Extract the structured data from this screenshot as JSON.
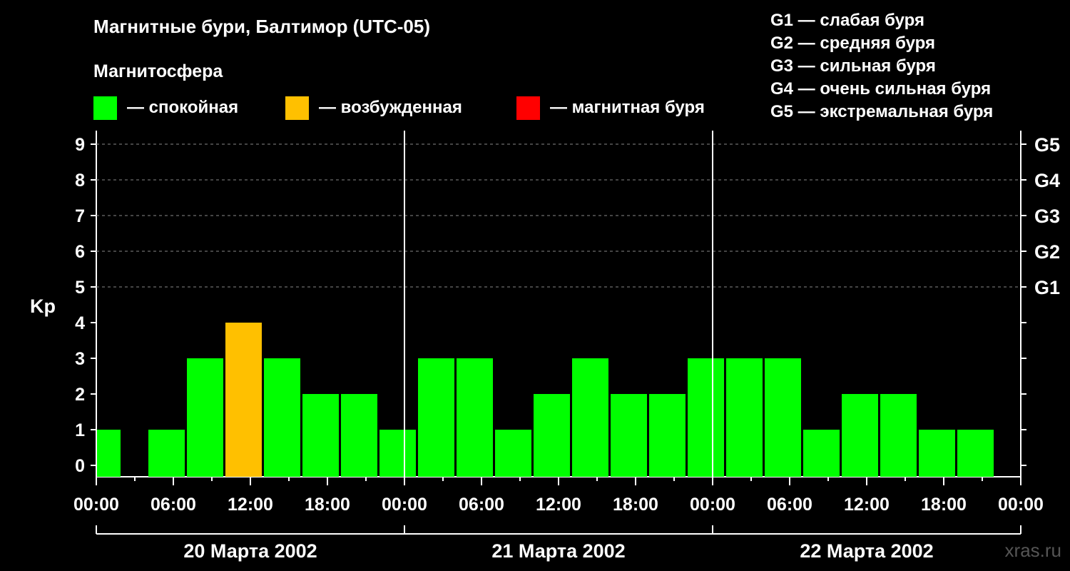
{
  "title": "Магнитные бури, Балтимор (UTC-05)",
  "subtitle": "Магнитосфера",
  "legend": [
    {
      "label": "— спокойная",
      "color": "#00ff00"
    },
    {
      "label": "— возбужденная",
      "color": "#ffc000"
    },
    {
      "label": "— магнитная буря",
      "color": "#ff0000"
    }
  ],
  "g_legend": [
    "G1 — слабая буря",
    "G2 — средняя буря",
    "G3 — сильная буря",
    "G4 — очень сильная буря",
    "G5 — экстремальная буря"
  ],
  "watermark": "xras.ru",
  "chart_data": {
    "type": "bar",
    "ylabel": "Kp",
    "ylim": [
      0,
      9
    ],
    "y_ticks": [
      "0",
      "1",
      "2",
      "3",
      "4",
      "5",
      "6",
      "7",
      "8",
      "9"
    ],
    "g_levels": [
      {
        "label": "G1",
        "value": 5
      },
      {
        "label": "G2",
        "value": 6
      },
      {
        "label": "G3",
        "value": 7
      },
      {
        "label": "G4",
        "value": 8
      },
      {
        "label": "G5",
        "value": 9
      }
    ],
    "x_tick_labels": [
      "00:00",
      "06:00",
      "12:00",
      "18:00",
      "00:00",
      "06:00",
      "12:00",
      "18:00",
      "00:00",
      "06:00",
      "12:00",
      "18:00",
      "00:00"
    ],
    "days": [
      "20 Марта 2002",
      "21 Марта 2002",
      "22 Марта 2002"
    ],
    "bars": [
      {
        "start_hour": 0,
        "end_hour": 2,
        "value": 1,
        "level": "quiet"
      },
      {
        "start_hour": 4,
        "end_hour": 7,
        "value": 1,
        "level": "quiet"
      },
      {
        "start_hour": 7,
        "end_hour": 10,
        "value": 3,
        "level": "quiet"
      },
      {
        "start_hour": 10,
        "end_hour": 13,
        "value": 4,
        "level": "active"
      },
      {
        "start_hour": 13,
        "end_hour": 16,
        "value": 3,
        "level": "quiet"
      },
      {
        "start_hour": 16,
        "end_hour": 19,
        "value": 2,
        "level": "quiet"
      },
      {
        "start_hour": 19,
        "end_hour": 22,
        "value": 2,
        "level": "quiet"
      },
      {
        "start_hour": 22,
        "end_hour": 25,
        "value": 1,
        "level": "quiet"
      },
      {
        "start_hour": 25,
        "end_hour": 28,
        "value": 3,
        "level": "quiet"
      },
      {
        "start_hour": 28,
        "end_hour": 31,
        "value": 3,
        "level": "quiet"
      },
      {
        "start_hour": 31,
        "end_hour": 34,
        "value": 1,
        "level": "quiet"
      },
      {
        "start_hour": 34,
        "end_hour": 37,
        "value": 2,
        "level": "quiet"
      },
      {
        "start_hour": 37,
        "end_hour": 40,
        "value": 3,
        "level": "quiet"
      },
      {
        "start_hour": 40,
        "end_hour": 43,
        "value": 2,
        "level": "quiet"
      },
      {
        "start_hour": 43,
        "end_hour": 46,
        "value": 2,
        "level": "quiet"
      },
      {
        "start_hour": 46,
        "end_hour": 49,
        "value": 3,
        "level": "quiet"
      },
      {
        "start_hour": 49,
        "end_hour": 52,
        "value": 3,
        "level": "quiet"
      },
      {
        "start_hour": 52,
        "end_hour": 55,
        "value": 3,
        "level": "quiet"
      },
      {
        "start_hour": 55,
        "end_hour": 58,
        "value": 1,
        "level": "quiet"
      },
      {
        "start_hour": 58,
        "end_hour": 61,
        "value": 2,
        "level": "quiet"
      },
      {
        "start_hour": 61,
        "end_hour": 64,
        "value": 2,
        "level": "quiet"
      },
      {
        "start_hour": 64,
        "end_hour": 67,
        "value": 1,
        "level": "quiet"
      },
      {
        "start_hour": 67,
        "end_hour": 70,
        "value": 1,
        "level": "quiet"
      }
    ],
    "colors": {
      "quiet": "#00ff00",
      "active": "#ffc000",
      "storm": "#ff0000"
    },
    "grid": true
  }
}
